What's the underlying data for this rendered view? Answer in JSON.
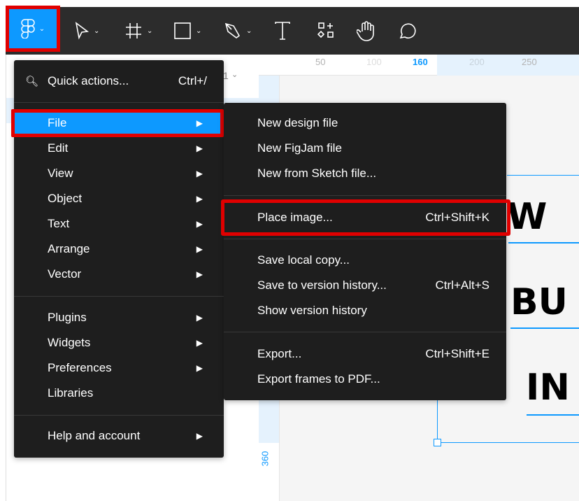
{
  "toolbar": {
    "tools": [
      "main-menu",
      "move",
      "frame",
      "shape",
      "pen",
      "text",
      "resources",
      "hand",
      "comment"
    ]
  },
  "ruler": {
    "top": [
      "50",
      "100",
      "160",
      "200",
      "250"
    ],
    "left": [
      "360"
    ]
  },
  "layers": {
    "page_chevron": "1"
  },
  "main_menu": {
    "quick_actions": {
      "label": "Quick actions...",
      "shortcut": "Ctrl+/"
    },
    "items": [
      {
        "label": "File"
      },
      {
        "label": "Edit"
      },
      {
        "label": "View"
      },
      {
        "label": "Object"
      },
      {
        "label": "Text"
      },
      {
        "label": "Arrange"
      },
      {
        "label": "Vector"
      }
    ],
    "items2": [
      {
        "label": "Plugins"
      },
      {
        "label": "Widgets"
      },
      {
        "label": "Preferences"
      },
      {
        "label": "Libraries"
      }
    ],
    "help": {
      "label": "Help and account"
    },
    "arrow": "▶"
  },
  "file_menu": {
    "items": [
      {
        "label": "New design file",
        "shortcut": ""
      },
      {
        "label": "New FigJam file",
        "shortcut": ""
      },
      {
        "label": "New from Sketch file...",
        "shortcut": ""
      },
      {
        "label": "Place image...",
        "shortcut": "Ctrl+Shift+K"
      },
      {
        "label": "Save local copy...",
        "shortcut": ""
      },
      {
        "label": "Save to version history...",
        "shortcut": "Ctrl+Alt+S"
      },
      {
        "label": "Show version history",
        "shortcut": ""
      },
      {
        "label": "Export...",
        "shortcut": "Ctrl+Shift+E"
      },
      {
        "label": "Export frames to PDF...",
        "shortcut": ""
      }
    ]
  },
  "canvas": {
    "lines": [
      "W",
      "BU",
      "IN"
    ]
  },
  "colors": {
    "accent": "#0d99ff",
    "highlight": "#e00000",
    "menu_bg": "#1e1e1e"
  }
}
